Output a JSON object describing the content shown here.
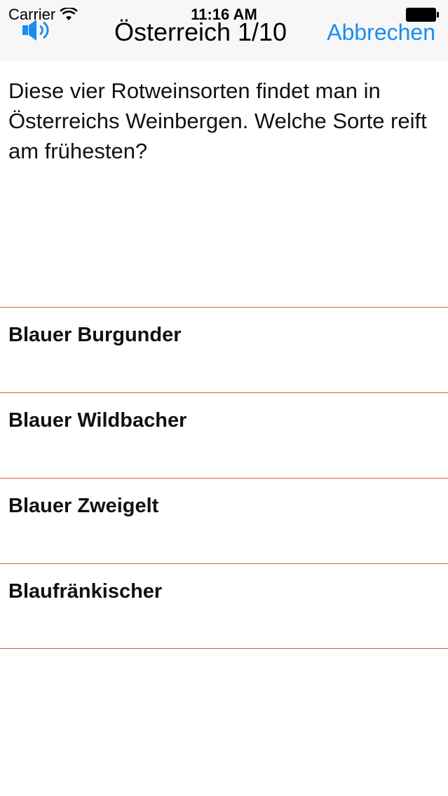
{
  "status_bar": {
    "carrier": "Carrier",
    "time": "11:16 AM"
  },
  "nav": {
    "title": "Österreich 1/10",
    "cancel_label": "Abbrechen",
    "speaker_icon": "speaker-icon"
  },
  "question": {
    "text": "Diese vier Rotweinsorten findet man in Österreichs Weinbergen. Welche Sorte reift am frühesten?"
  },
  "answers": [
    {
      "label": "Blauer Burgunder"
    },
    {
      "label": "Blauer Wildbacher"
    },
    {
      "label": "Blauer Zweigelt"
    },
    {
      "label": "Blaufränkischer"
    }
  ],
  "colors": {
    "accent": "#1a8cf0",
    "divider": "#e8534a",
    "bar_background": "#f7f7f7"
  }
}
